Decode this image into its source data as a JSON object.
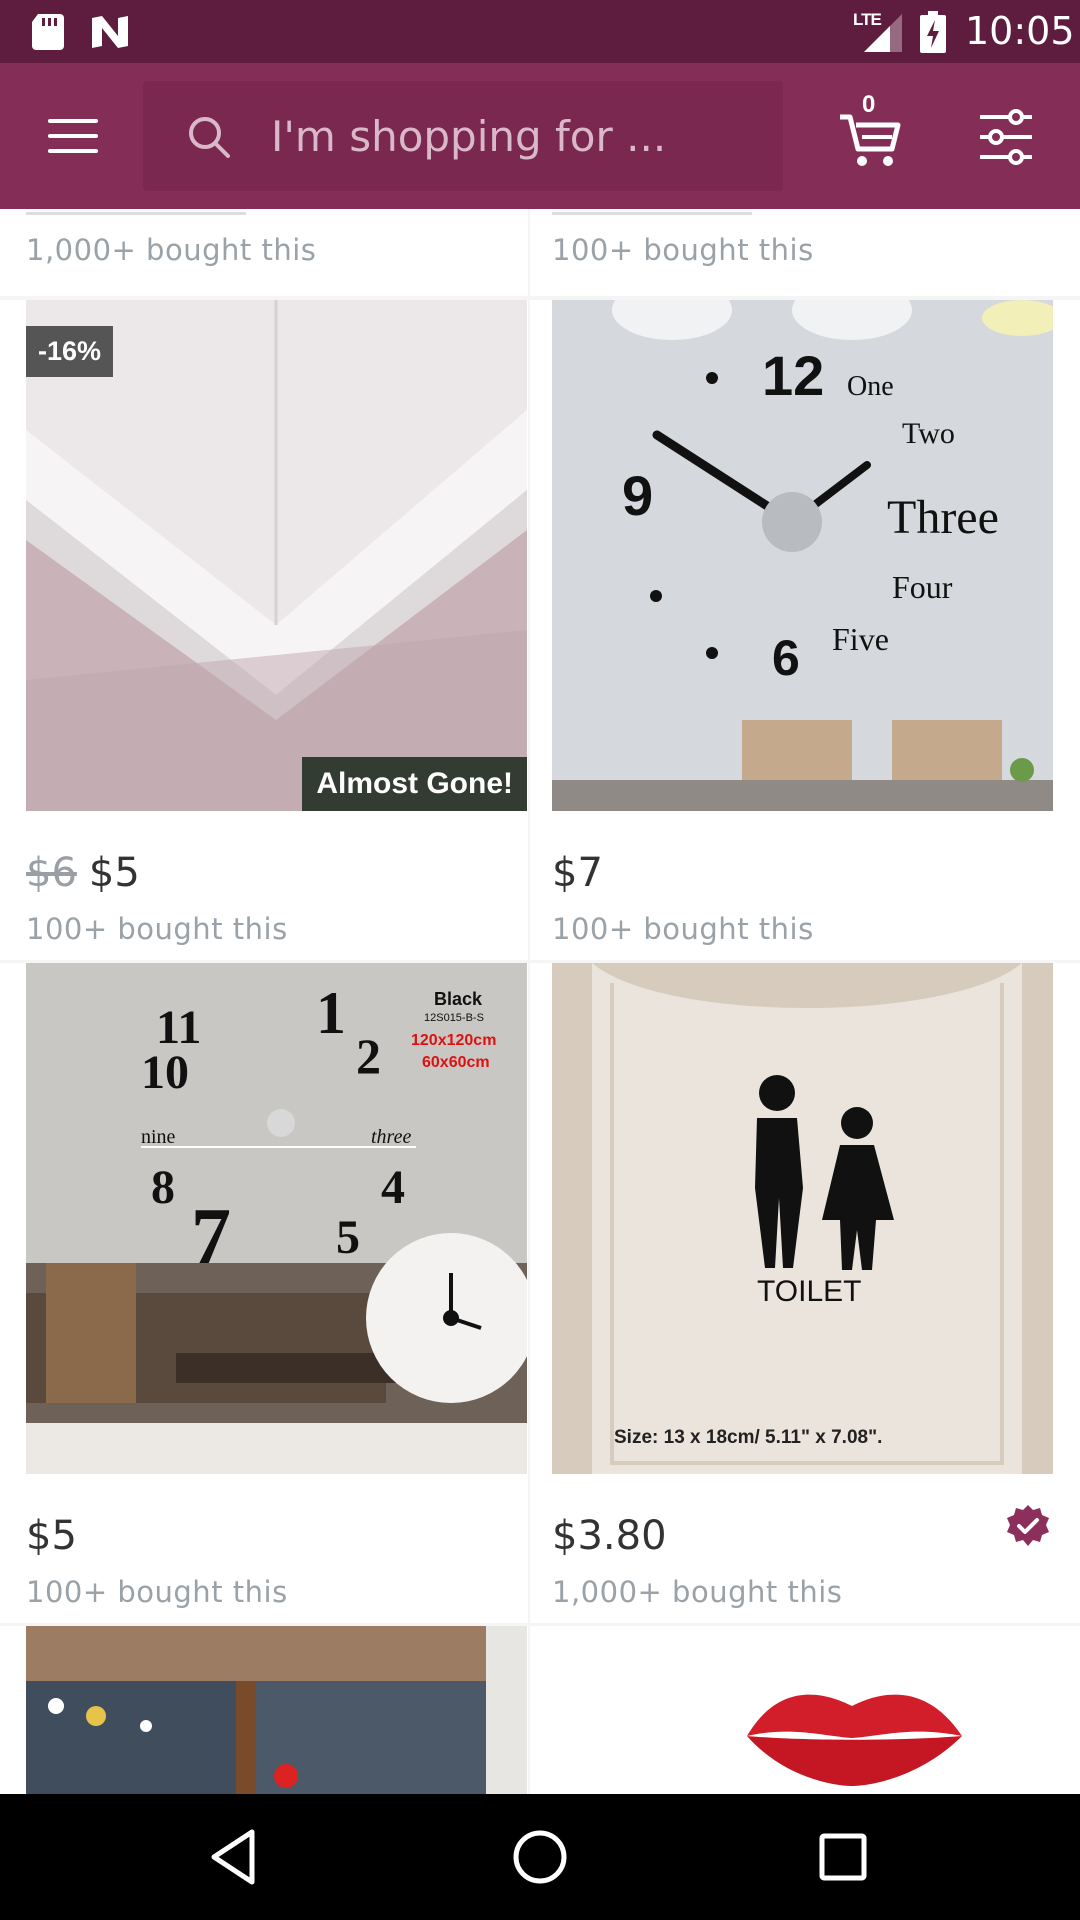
{
  "status_bar": {
    "network": "LTE",
    "time": "10:05"
  },
  "header": {
    "search_placeholder": "I'm shopping for ...",
    "cart_count": "0"
  },
  "products_top_partial": [
    {
      "bought": "1,000+ bought this"
    },
    {
      "bought": "100+ bought this"
    }
  ],
  "products": [
    {
      "image": "white-corner-molding",
      "discount_badge": "-16%",
      "status_badge": "Almost Gone!",
      "old_price": "$6",
      "price": "$5",
      "bought": "100+ bought this"
    },
    {
      "image": "wall-clock-words",
      "price": "$7",
      "bought": "100+ bought this"
    },
    {
      "image": "diy-wall-clock-living-room",
      "image_text": {
        "color": "Black",
        "sku": "12S015-B-S",
        "size1": "120x120cm",
        "size2": "60x60cm"
      },
      "price": "$5",
      "bought": "100+ bought this"
    },
    {
      "image": "toilet-door-sticker",
      "image_text": {
        "label": "TOILET",
        "size": "Size: 13 x 18cm/ 5.11\" x 7.08\"."
      },
      "price": "$3.80",
      "bought": "1,000+ bought this",
      "verified": true
    }
  ],
  "products_bottom_partial": [
    {
      "image": "christmas-window-stickers"
    },
    {
      "image": "red-lips-sticker"
    }
  ],
  "colors": {
    "status_bar": "#5e1d3e",
    "header": "#842e57",
    "verified": "#8c2f5c"
  }
}
